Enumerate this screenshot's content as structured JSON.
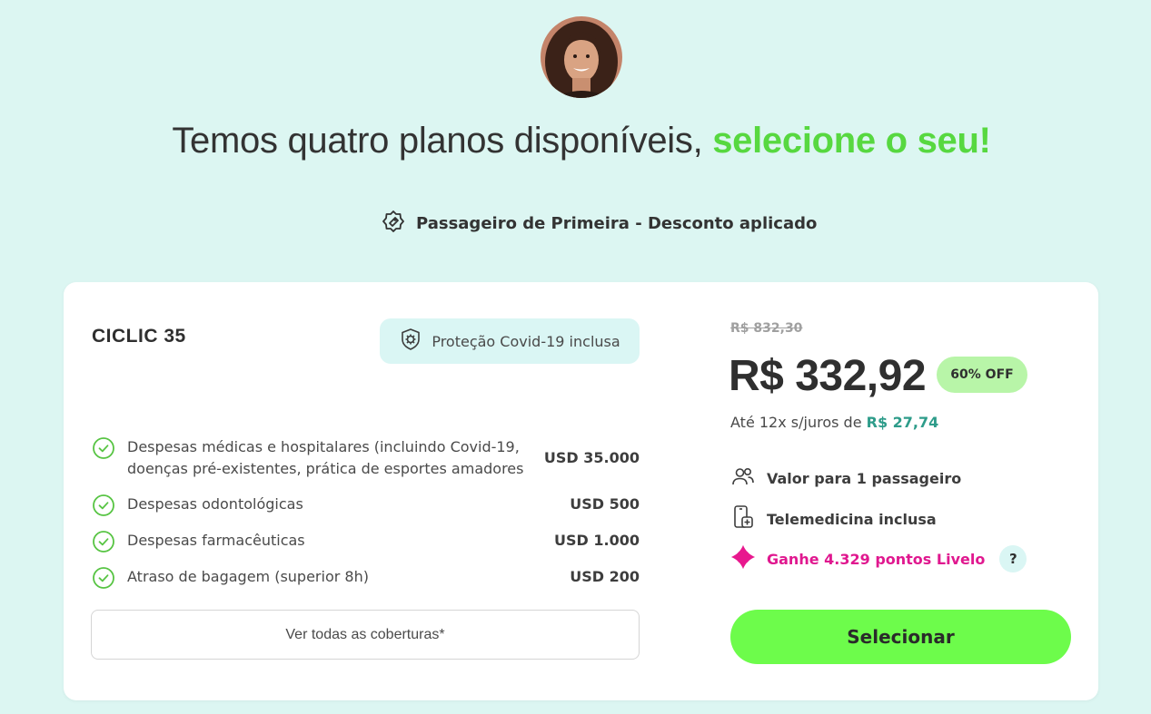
{
  "header": {
    "headline_prefix": "Temos quatro planos disponíveis, ",
    "headline_accent": "selecione o seu!",
    "discount_label": "Passageiro de Primeira - Desconto aplicado"
  },
  "plan": {
    "name": "CICLIC 35",
    "covid_badge": "Proteção Covid-19 inclusa",
    "coverages": [
      {
        "label": "Despesas médicas e hospitalares (incluindo Covid-19, doenças pré-existentes, prática de esportes amadores e…",
        "value": "USD 35.000"
      },
      {
        "label": "Despesas odontológicas",
        "value": "USD 500"
      },
      {
        "label": "Despesas farmacêuticas",
        "value": "USD 1.000"
      },
      {
        "label": "Atraso de bagagem (superior 8h)",
        "value": "USD 200"
      }
    ],
    "all_coverages_label": "Ver todas as coberturas*",
    "old_price": "R$ 832,30",
    "price": "R$ 332,92",
    "discount_badge": "60% OFF",
    "installments_prefix": "Até 12x s/juros de ",
    "installments_value": "R$ 27,74",
    "features": {
      "passengers": "Valor para 1 passageiro",
      "telemedicine": "Telemedicina inclusa",
      "livelo": "Ganhe 4.329 pontos Livelo",
      "help": "?"
    },
    "select_label": "Selecionar"
  },
  "colors": {
    "background": "#dcf6f2",
    "accent_green": "#57d840",
    "button_green": "#6dfc4b",
    "livelo_pink": "#e0188f",
    "installment_teal": "#2e9c8a"
  },
  "icons": [
    "avatar",
    "discount-tag-icon",
    "shield-virus-icon",
    "check-circle-icon",
    "users-icon",
    "phone-plus-icon",
    "livelo-icon"
  ]
}
